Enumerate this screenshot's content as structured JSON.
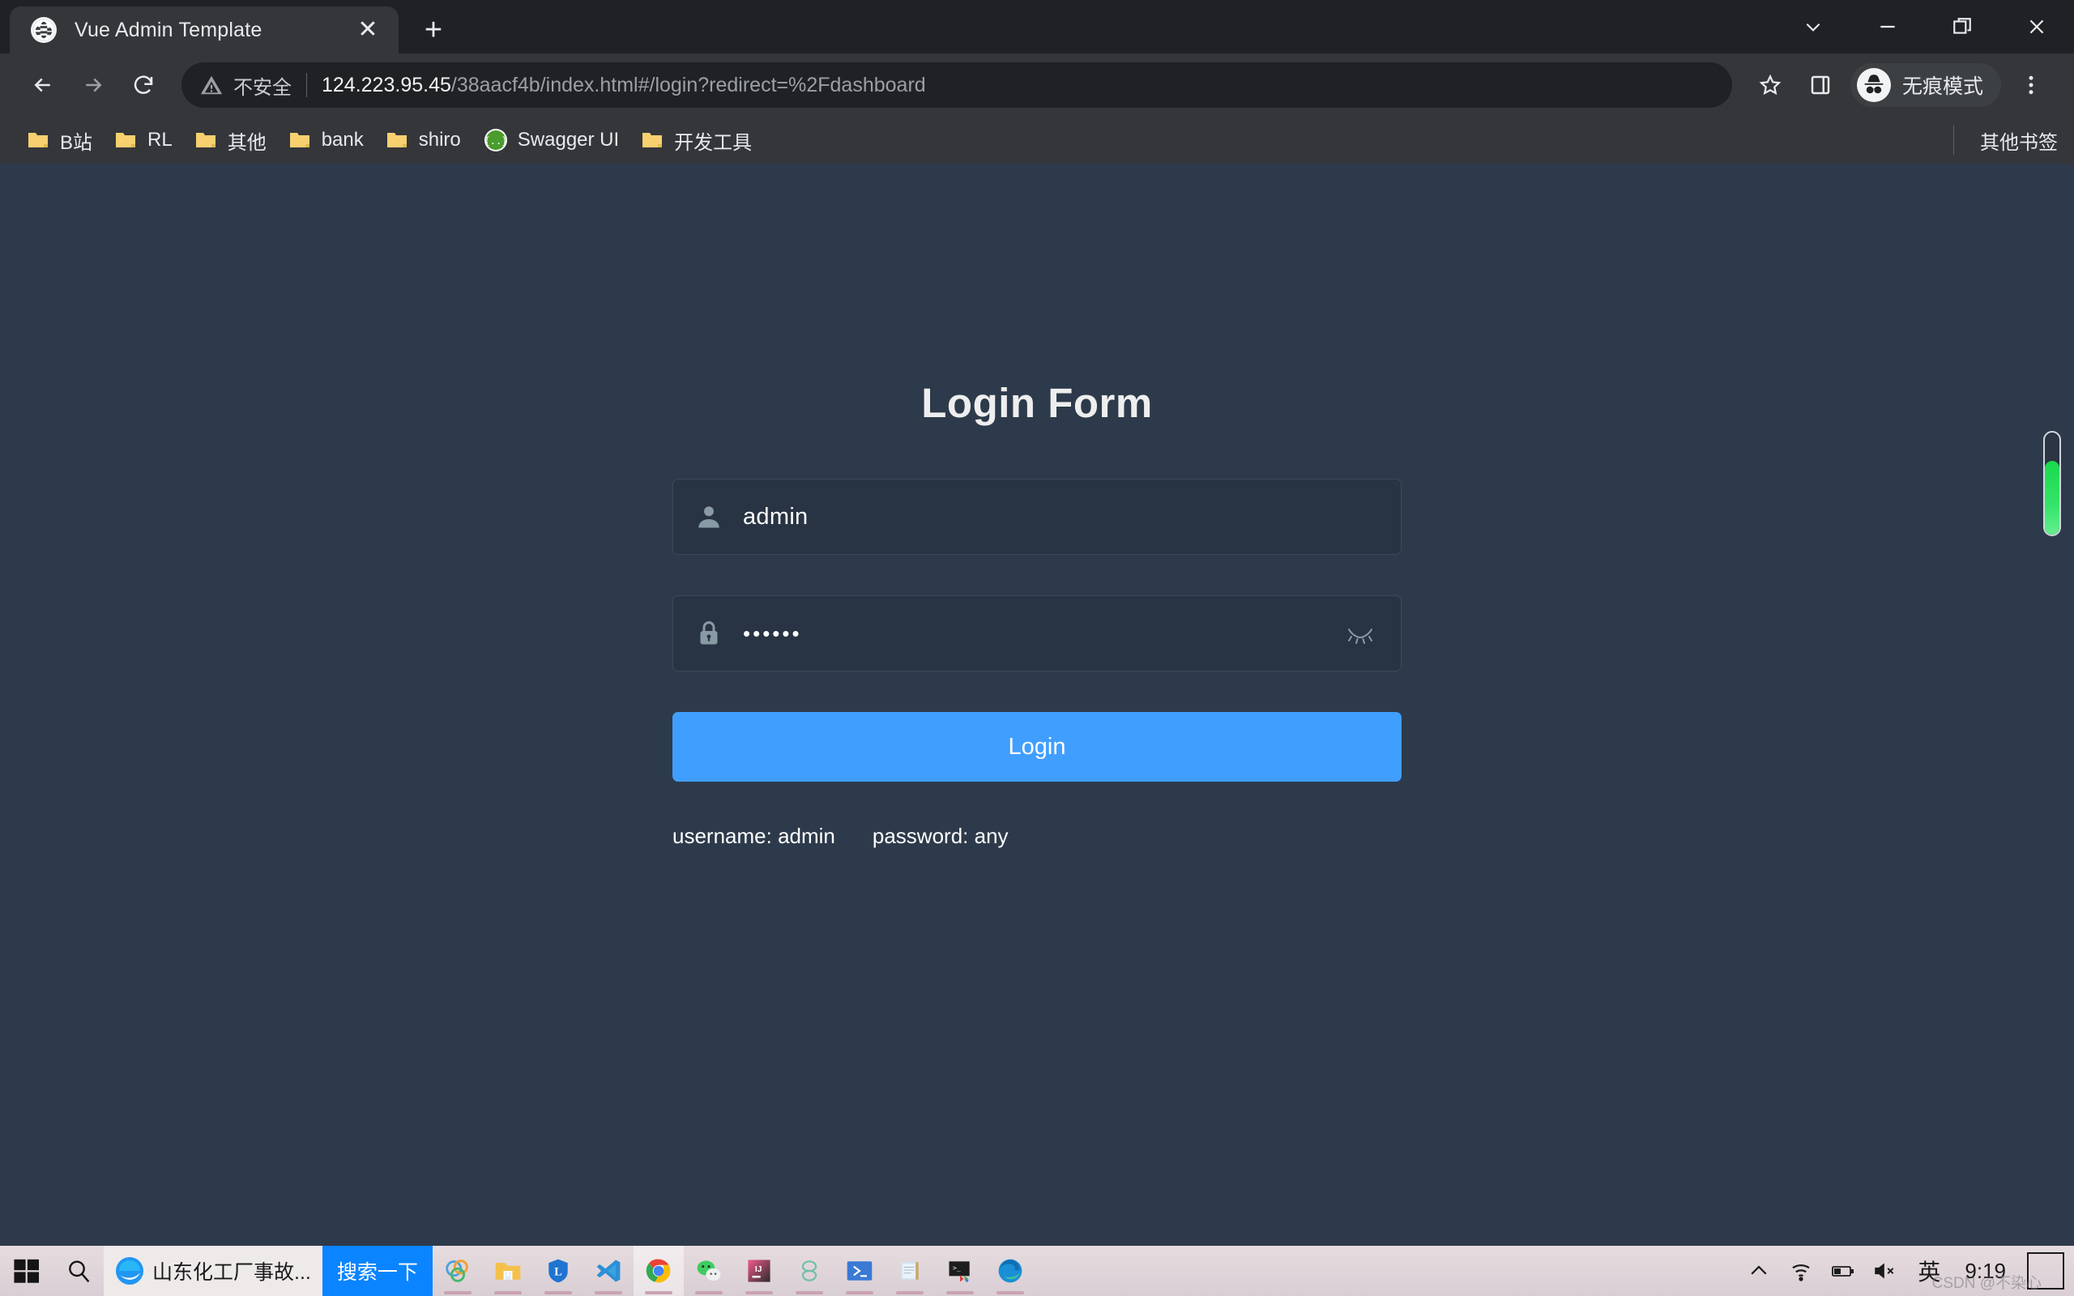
{
  "browser": {
    "tab": {
      "title": "Vue Admin Template",
      "favicon": "globe-icon",
      "close_label": "✕"
    },
    "new_tab_label": "+",
    "window_controls": {
      "minimize": "—",
      "maximize": "❐",
      "close": "✕",
      "tab_search": "⌄"
    },
    "omnibox": {
      "security_label": "不安全",
      "url_host": "124.223.95.45",
      "url_path": "/38aacf4b/index.html#/login?redirect=%2Fdashboard",
      "full_url": "124.223.95.45/38aacf4b/index.html#/login?redirect=%2Fdashboard"
    },
    "nav": {
      "back": "back-icon",
      "forward": "forward-icon",
      "reload": "reload-icon"
    },
    "actions": {
      "bookmark_star": "star-icon",
      "side_panel": "side-panel-icon",
      "incognito_label": "无痕模式",
      "menu": "kebab-menu-icon"
    },
    "bookmarks": [
      {
        "label": "B站",
        "icon": "folder-icon"
      },
      {
        "label": "RL",
        "icon": "folder-icon"
      },
      {
        "label": "其他",
        "icon": "folder-icon"
      },
      {
        "label": "bank",
        "icon": "folder-icon"
      },
      {
        "label": "shiro",
        "icon": "folder-icon"
      },
      {
        "label": "Swagger UI",
        "icon": "swagger-icon"
      },
      {
        "label": "开发工具",
        "icon": "folder-icon"
      }
    ],
    "other_bookmarks": {
      "label": "其他书签",
      "icon": "folder-icon"
    }
  },
  "page": {
    "title": "Login Form",
    "username": {
      "value": "admin",
      "icon": "user-icon"
    },
    "password": {
      "value": "••••••",
      "icon": "lock-icon",
      "toggle_icon": "eye-closed-icon"
    },
    "login_button": "Login",
    "tips": {
      "username": "username: admin",
      "password": "password: any"
    },
    "colors": {
      "background": "#2d3a4b",
      "field": "#283443",
      "accent": "#409EFF",
      "title": "#eeeeee"
    }
  },
  "taskbar": {
    "start": "windows-start-icon",
    "search_icon": "search-icon",
    "search_value": "山东化工厂事故...",
    "search_button": "搜索一下",
    "apps": [
      {
        "name": "navicat-icon"
      },
      {
        "name": "file-explorer-icon"
      },
      {
        "name": "lenovo-icon"
      },
      {
        "name": "vscode-icon"
      },
      {
        "name": "chrome-icon"
      },
      {
        "name": "wechat-icon"
      },
      {
        "name": "intellij-idea-icon"
      },
      {
        "name": "everything-icon"
      },
      {
        "name": "powershell-icon"
      },
      {
        "name": "notepad-icon"
      },
      {
        "name": "cmder-icon"
      },
      {
        "name": "edge-icon"
      }
    ],
    "tray": {
      "overflow": "chevron-up-icon",
      "network": "wifi-icon",
      "battery": "battery-icon",
      "volume": "volume-muted-icon",
      "ime": "英",
      "time": "9:19",
      "action_center": "action-center-icon"
    },
    "watermark": "CSDN @不染心"
  }
}
